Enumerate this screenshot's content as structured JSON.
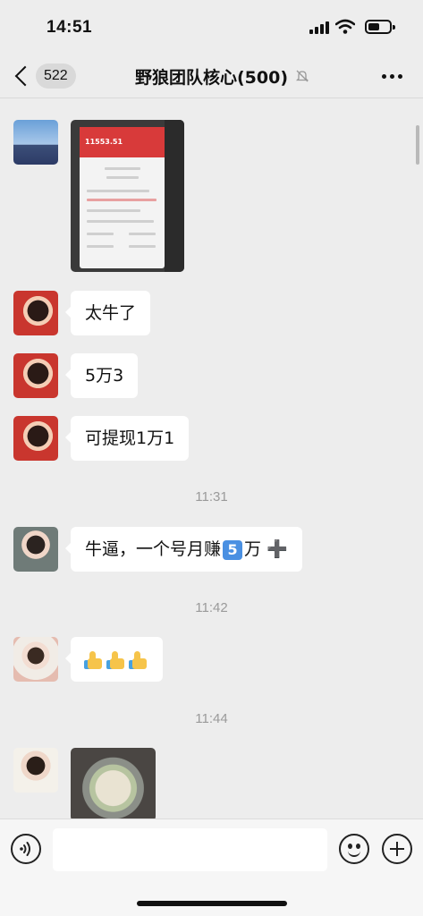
{
  "status_bar": {
    "time": "14:51"
  },
  "nav": {
    "unread_count": "522",
    "title": "野狼团队核心(500)",
    "muted": true
  },
  "image_messages": {
    "screenshot": {
      "amount_text": "11553.51"
    }
  },
  "messages": [
    {
      "text": "太牛了"
    },
    {
      "text": "5万3"
    },
    {
      "text": "可提现1万1"
    },
    {
      "text_before": "牛逼，一个号月赚",
      "badge": "5",
      "text_after": "万",
      "plus": "➕"
    }
  ],
  "timestamps": [
    "11:31",
    "11:42",
    "11:44"
  ],
  "input": {
    "placeholder": ""
  },
  "icons": {
    "voice": "voice-icon",
    "emoji": "emoji-icon",
    "plus": "plus-icon",
    "more": "more-icon",
    "back": "back-chevron-icon",
    "mute": "mute-bell-icon",
    "thumbs": "thumbs-up-icon"
  },
  "colors": {
    "background": "#ededed",
    "bubble": "#ffffff",
    "timestamp": "#9a9a9a"
  }
}
